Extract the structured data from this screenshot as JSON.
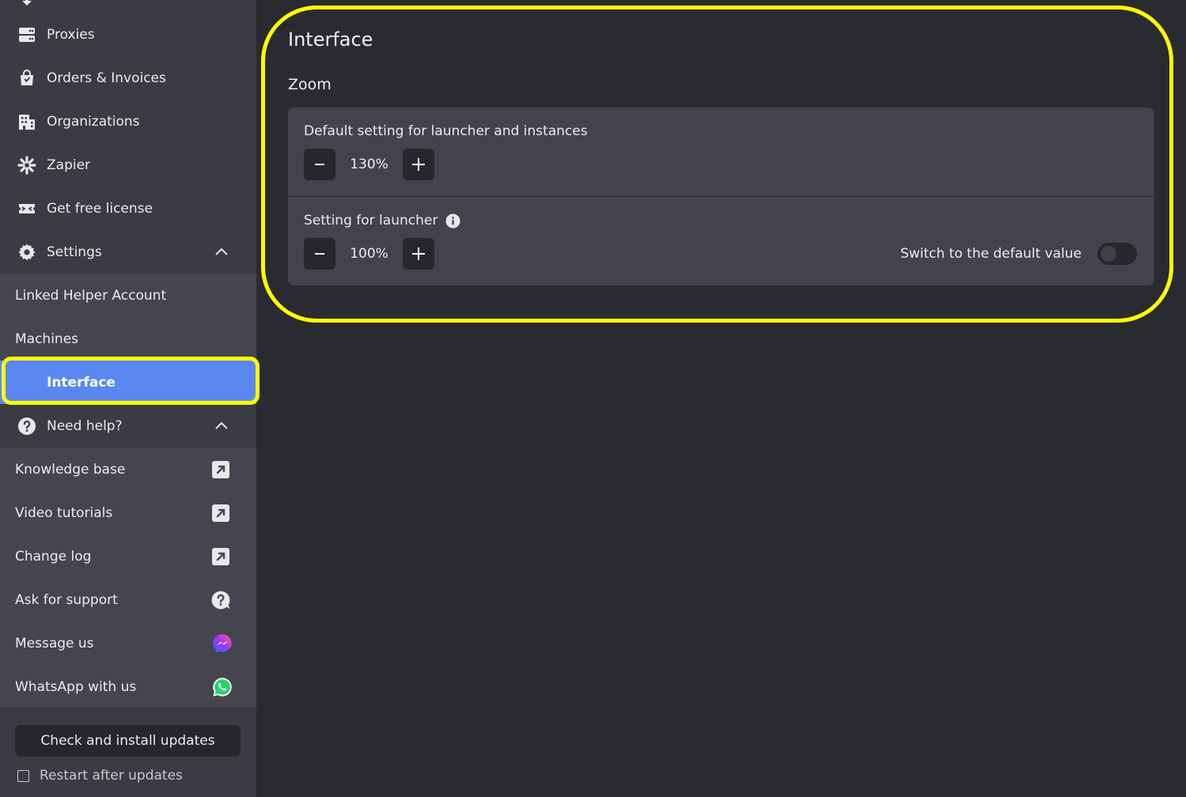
{
  "sidebar": {
    "items": [
      {
        "label": "Proxies",
        "icon": "proxies-icon"
      },
      {
        "label": "Orders & Invoices",
        "icon": "shopping-bag-icon"
      },
      {
        "label": "Organizations",
        "icon": "building-icon"
      },
      {
        "label": "Zapier",
        "icon": "zapier-icon"
      },
      {
        "label": "Get free license",
        "icon": "ticket-icon"
      },
      {
        "label": "Settings",
        "icon": "gear-icon"
      }
    ],
    "settings_sub": [
      {
        "label": "Linked Helper Account"
      },
      {
        "label": "Machines"
      },
      {
        "label": "Interface"
      }
    ],
    "help": {
      "label": "Need help?",
      "icon": "question-circle-icon"
    },
    "help_sub": [
      {
        "label": "Knowledge base",
        "icon": "external-link-icon"
      },
      {
        "label": "Video tutorials",
        "icon": "external-link-icon"
      },
      {
        "label": "Change log",
        "icon": "external-link-icon"
      },
      {
        "label": "Ask for support",
        "icon": "support-chat-icon"
      },
      {
        "label": "Message us",
        "icon": "messenger-icon"
      },
      {
        "label": "WhatsApp with us",
        "icon": "whatsapp-icon"
      }
    ],
    "update_button": "Check and install updates",
    "restart_label": "Restart after updates",
    "restart_checked": false
  },
  "main": {
    "title": "Interface",
    "section": "Zoom",
    "default_setting": {
      "label": "Default setting for launcher and instances",
      "value": "130%"
    },
    "launcher_setting": {
      "label": "Setting for launcher",
      "value": "100%",
      "switch_label": "Switch to the default value",
      "switch_on": false
    }
  },
  "colors": {
    "accent": "#5a88f0",
    "highlight": "#ffff00",
    "background": "#2a2b31",
    "sidebar": "#3a3b43"
  }
}
